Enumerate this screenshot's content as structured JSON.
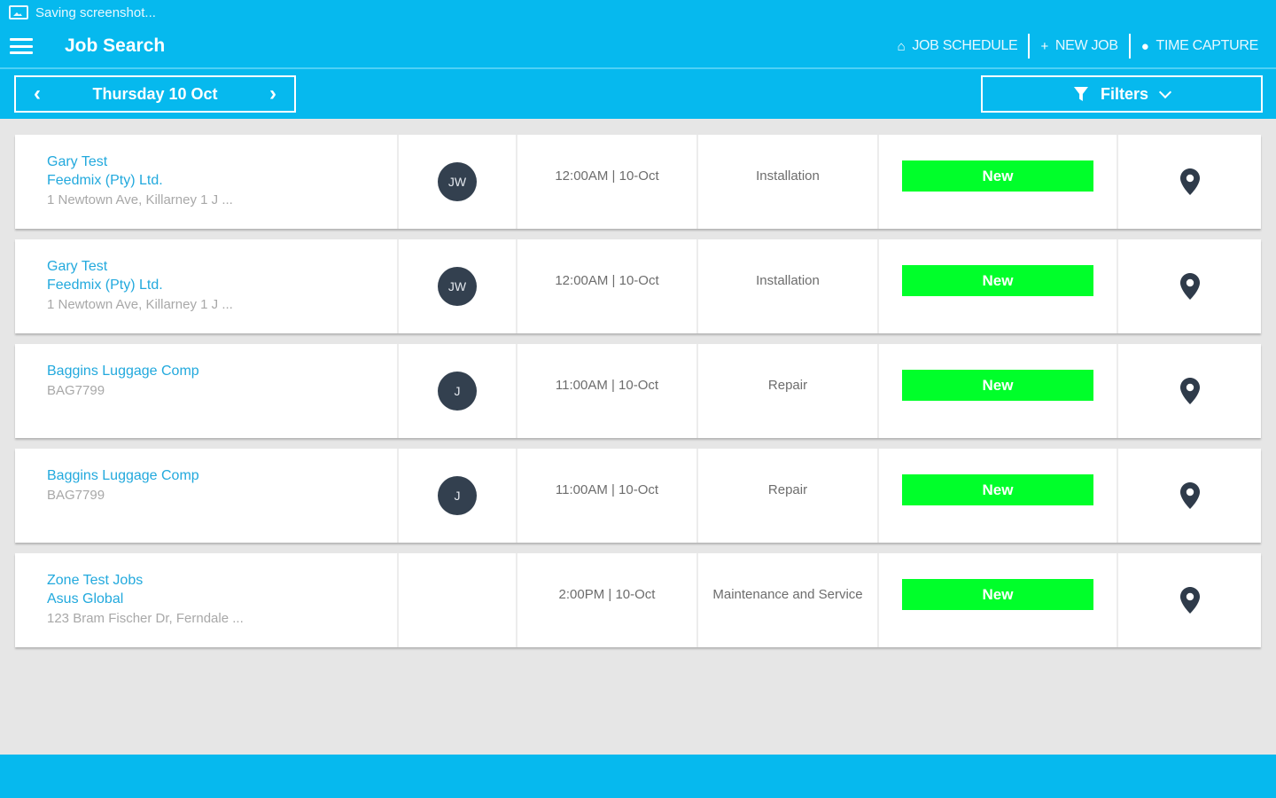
{
  "status_bar": {
    "text": "Saving screenshot..."
  },
  "appbar": {
    "title": "Job Search",
    "actions": [
      {
        "icon": "home-icon",
        "glyph": "⌂",
        "label": "JOB SCHEDULE"
      },
      {
        "icon": "plus-icon",
        "glyph": "+",
        "label": "NEW JOB"
      },
      {
        "icon": "clock-icon",
        "glyph": "●",
        "label": "TIME CAPTURE"
      }
    ]
  },
  "toolbar": {
    "date_label": "Thursday 10 Oct",
    "prev_glyph": "‹",
    "next_glyph": "›",
    "filters_label": "Filters"
  },
  "colors": {
    "primary": "#06b9ee",
    "status_new": "#00ff2a",
    "avatar": "#33404f",
    "link": "#22a9dd"
  },
  "jobs": [
    {
      "title": "Gary Test",
      "company": "Feedmix (Pty) Ltd.",
      "address": "1 Newtown Ave, Killarney 1 J ...",
      "avatar": "JW",
      "time": "12:00AM | 10-Oct",
      "type": "Installation",
      "status": "New"
    },
    {
      "title": "Gary Test",
      "company": "Feedmix (Pty) Ltd.",
      "address": "1 Newtown Ave, Killarney 1 J ...",
      "avatar": "JW",
      "time": "12:00AM | 10-Oct",
      "type": "Installation",
      "status": "New"
    },
    {
      "title": "Baggins Luggage Comp",
      "company": "",
      "address": "BAG7799",
      "avatar": "J",
      "time": "11:00AM | 10-Oct",
      "type": "Repair",
      "status": "New"
    },
    {
      "title": "Baggins Luggage Comp",
      "company": "",
      "address": "BAG7799",
      "avatar": "J",
      "time": "11:00AM | 10-Oct",
      "type": "Repair",
      "status": "New"
    },
    {
      "title": "Zone Test Jobs",
      "company": "Asus Global",
      "address": "123 Bram Fischer Dr, Ferndale ...",
      "avatar": "",
      "time": "2:00PM | 10-Oct",
      "type": "Maintenance and Service",
      "status": "New"
    }
  ]
}
